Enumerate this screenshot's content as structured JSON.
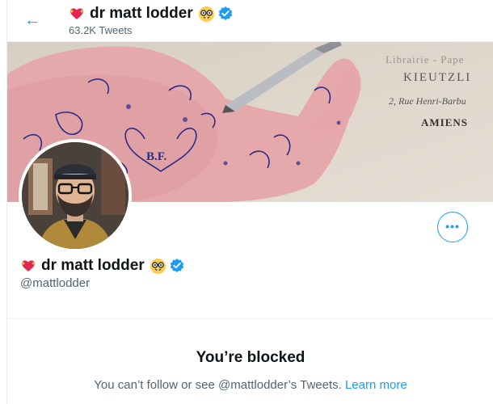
{
  "header": {
    "back_icon": "arrow-left-icon",
    "name": "dr matt lodder",
    "tweet_count": "63.2K Tweets"
  },
  "banner": {
    "lines": [
      "Librairie - Pape",
      "KIEUTZLI",
      "2, Rue Henri-Barbu",
      "AMIENS"
    ],
    "tattoo_text": "B.F."
  },
  "profile": {
    "name": "dr matt lodder",
    "handle": "@mattlodder",
    "name_icons": [
      "heart-with-ribbon-icon",
      "nerd-face-icon",
      "verified-badge-icon"
    ],
    "more_label": "•••"
  },
  "blocked": {
    "title": "You’re blocked",
    "message": "You can’t follow or see @mattlodder’s Tweets.",
    "link": "Learn more"
  },
  "colors": {
    "accent": "#1d9bf0",
    "text": "#0f1419",
    "muted": "#536471"
  }
}
